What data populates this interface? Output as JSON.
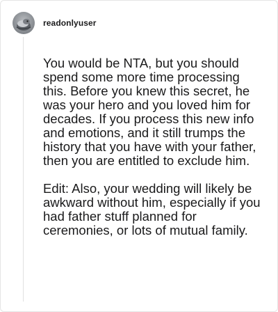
{
  "comment": {
    "username": "readonlyuser",
    "avatar_icon": "avatar-icon",
    "paragraphs": [
      "You would be NTA, but you should spend some more time processing this. Before you knew this secret, he was your hero and you loved him for decades. If you process this new info and emotions, and it still trumps the history that you have with your father, then you are entitled to exclude him.",
      "Edit: Also, your wedding will likely be awkward without him, especially if you had father stuff planned for ceremonies, or lots of mutual family."
    ]
  }
}
